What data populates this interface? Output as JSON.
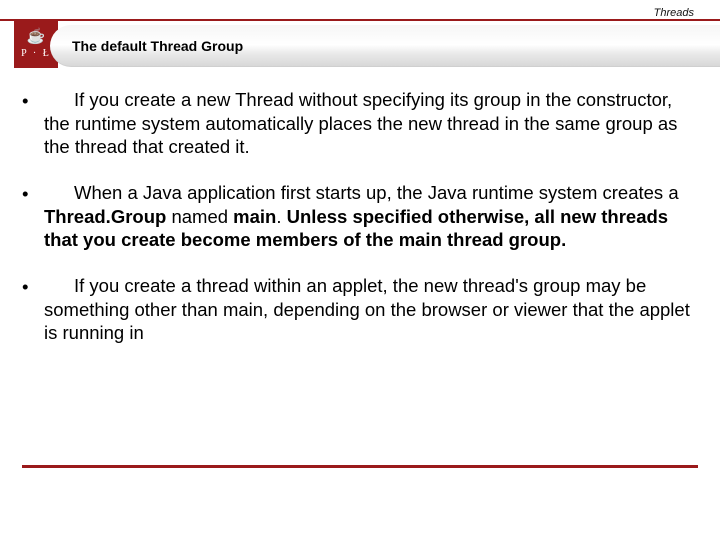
{
  "header": {
    "top_label": "Threads",
    "title": "The default Thread Group",
    "logo_top": "☕",
    "logo_bottom": "P · Ł"
  },
  "bullets": [
    {
      "segments": [
        {
          "text": "If you create a new Thread without specifying its group in the constructor, the runtime system automatically places the new thread in the same group as the thread that created it.",
          "bold": false
        }
      ]
    },
    {
      "segments": [
        {
          "text": "When a Java application first starts up, the Java runtime system creates a ",
          "bold": false
        },
        {
          "text": "Thread.Group",
          "bold": true
        },
        {
          "text": " named ",
          "bold": false
        },
        {
          "text": "main",
          "bold": true
        },
        {
          "text": ". ",
          "bold": false
        },
        {
          "text": "Unless specified otherwise, all new threads that you create become members of the main thread group.",
          "bold": true
        }
      ]
    },
    {
      "segments": [
        {
          "text": "If you create a thread within an applet, the new thread's group may be something other than main, depending on the browser or viewer that the applet is running in",
          "bold": false
        }
      ]
    }
  ]
}
